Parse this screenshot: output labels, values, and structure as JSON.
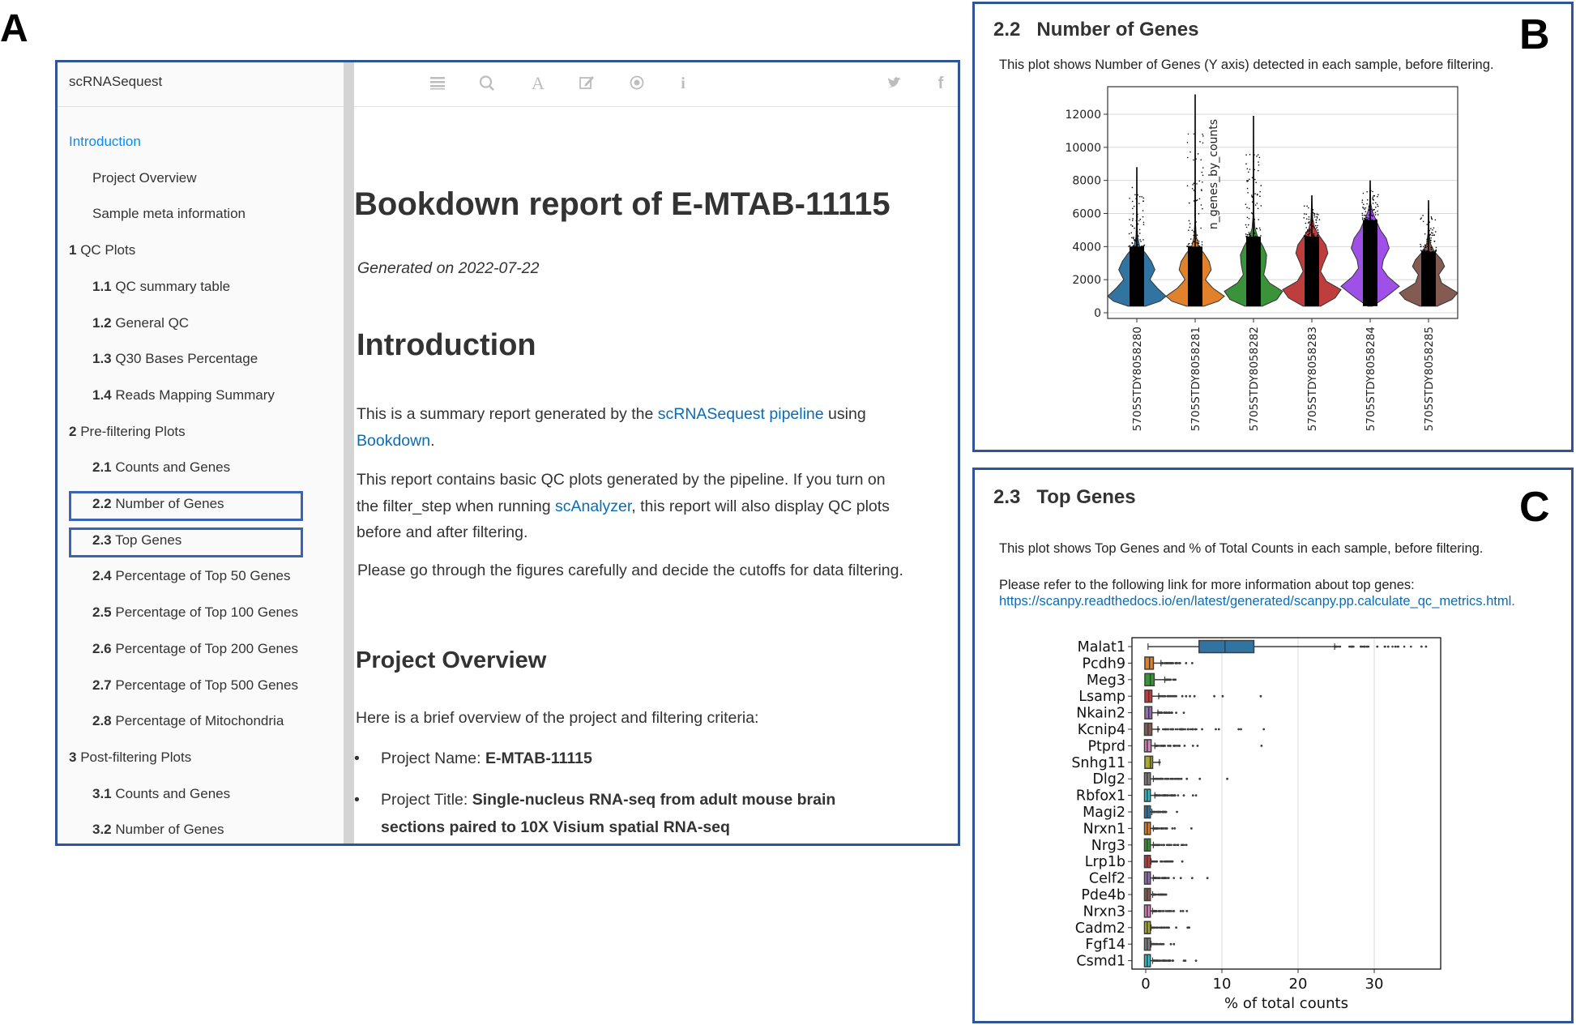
{
  "labels": {
    "a": "A",
    "b": "B",
    "c": "C"
  },
  "sidebar": {
    "title": "scRNASequest",
    "items": [
      {
        "num": "",
        "label": "Introduction",
        "level": 1,
        "active": true
      },
      {
        "num": "",
        "label": "Project Overview",
        "level": 2
      },
      {
        "num": "",
        "label": "Sample meta information",
        "level": 2
      },
      {
        "num": "1",
        "label": "QC Plots",
        "level": 1
      },
      {
        "num": "1.1",
        "label": "QC summary table",
        "level": 2
      },
      {
        "num": "1.2",
        "label": "General QC",
        "level": 2
      },
      {
        "num": "1.3",
        "label": "Q30 Bases Percentage",
        "level": 2
      },
      {
        "num": "1.4",
        "label": "Reads Mapping Summary",
        "level": 2
      },
      {
        "num": "2",
        "label": "Pre-filtering Plots",
        "level": 1
      },
      {
        "num": "2.1",
        "label": "Counts and Genes",
        "level": 2
      },
      {
        "num": "2.2",
        "label": "Number of Genes",
        "level": 2,
        "highlighted": true
      },
      {
        "num": "2.3",
        "label": "Top Genes",
        "level": 2,
        "highlighted": true
      },
      {
        "num": "2.4",
        "label": "Percentage of Top 50 Genes",
        "level": 2
      },
      {
        "num": "2.5",
        "label": "Percentage of Top 100 Genes",
        "level": 2
      },
      {
        "num": "2.6",
        "label": "Percentage of Top 200 Genes",
        "level": 2
      },
      {
        "num": "2.7",
        "label": "Percentage of Top 500 Genes",
        "level": 2
      },
      {
        "num": "2.8",
        "label": "Percentage of Mitochondria",
        "level": 2
      },
      {
        "num": "3",
        "label": "Post-filtering Plots",
        "level": 1
      },
      {
        "num": "3.1",
        "label": "Counts and Genes",
        "level": 2
      },
      {
        "num": "3.2",
        "label": "Number of Genes",
        "level": 2
      }
    ]
  },
  "toolbar": {
    "left_icons": [
      "menu-icon",
      "search-icon",
      "font-icon",
      "edit-icon",
      "eye-icon",
      "info-icon"
    ],
    "right_icons": [
      "twitter-icon",
      "facebook-icon",
      "share-icon"
    ]
  },
  "main": {
    "title": "Bookdown report of E-MTAB-11115",
    "generated": "Generated on 2022-07-22",
    "intro_heading": "Introduction",
    "p1_a": "This is a summary report generated by the ",
    "p1_link": "scRNASequest pipeline",
    "p1_b": " using",
    "p1_link2": "Bookdown",
    "p1_c": ".",
    "p2_line1": "This report contains basic QC plots generated by the pipeline. If you turn on",
    "p2_a": "the filter_step when running ",
    "p2_link": "scAnalyzer",
    "p2_b": ", this report will also display QC plots",
    "p2_line3": "before and after filtering.",
    "p3": "Please go through the figures carefully and decide the cutoffs for data filtering.",
    "overview_heading": "Project Overview",
    "overview_intro": "Here is a brief overview of the project and filtering criteria:",
    "bullet": "•",
    "project_name_label": "Project Name: ",
    "project_name": "E-MTAB-11115",
    "project_title_label": "Project Title: ",
    "project_title_line1": "Single-nucleus RNA-seq from adult mouse brain",
    "project_title_line2": "sections paired to 10X Visium spatial RNA-seq"
  },
  "panel_b": {
    "section_num": "2.2",
    "section_title": "Number of Genes",
    "description": "This plot shows Number of Genes (Y axis) detected in each sample, before filtering."
  },
  "panel_c": {
    "section_num": "2.3",
    "section_title": "Top Genes",
    "description": "This plot shows Top Genes and % of Total Counts in each sample, before filtering.",
    "refer": "Please refer to the following link for more information about top genes:",
    "link": "https://scanpy.readthedocs.io/en/latest/generated/scanpy.pp.calculate_qc_metrics.html."
  },
  "chart_data": [
    {
      "type": "violin",
      "ylabel": "n_genes_by_counts",
      "xlabel": "",
      "ylim": [
        -340,
        13660
      ],
      "yticks": [
        0,
        2000,
        4000,
        6000,
        8000,
        10000,
        12000
      ],
      "grid": true,
      "categories": [
        "5705STDY8058280",
        "5705STDY8058281",
        "5705STDY8058282",
        "5705STDY8058283",
        "5705STDY8058284",
        "5705STDY8058285"
      ],
      "colors": [
        "#3274a1",
        "#e1812c",
        "#3a923a",
        "#c03d3e",
        "#9f50e6",
        "#845b53"
      ],
      "series": [
        {
          "min": 400,
          "max": 8800,
          "density": [
            [
              400,
              0.3
            ],
            [
              700,
              0.8
            ],
            [
              1000,
              1.0
            ],
            [
              1500,
              0.7
            ],
            [
              2000,
              0.45
            ],
            [
              2600,
              0.62
            ],
            [
              3100,
              0.5
            ],
            [
              3600,
              0.3
            ],
            [
              4000,
              0.1
            ],
            [
              4600,
              0.03
            ],
            [
              5500,
              0.01
            ]
          ]
        },
        {
          "min": 400,
          "max": 13200,
          "density": [
            [
              400,
              0.3
            ],
            [
              700,
              0.8
            ],
            [
              1000,
              1.0
            ],
            [
              1500,
              0.6
            ],
            [
              2000,
              0.35
            ],
            [
              2600,
              0.55
            ],
            [
              3100,
              0.48
            ],
            [
              3600,
              0.3
            ],
            [
              4000,
              0.12
            ],
            [
              4600,
              0.04
            ],
            [
              5500,
              0.01
            ]
          ]
        },
        {
          "min": 400,
          "max": 11900,
          "density": [
            [
              400,
              0.3
            ],
            [
              800,
              0.8
            ],
            [
              1300,
              1.0
            ],
            [
              1800,
              0.55
            ],
            [
              2300,
              0.35
            ],
            [
              2900,
              0.42
            ],
            [
              3500,
              0.45
            ],
            [
              4000,
              0.33
            ],
            [
              4600,
              0.14
            ],
            [
              5100,
              0.05
            ],
            [
              6000,
              0.01
            ]
          ]
        },
        {
          "min": 400,
          "max": 7100,
          "density": [
            [
              400,
              0.3
            ],
            [
              900,
              0.8
            ],
            [
              1400,
              1.0
            ],
            [
              1900,
              0.5
            ],
            [
              2500,
              0.3
            ],
            [
              3000,
              0.4
            ],
            [
              3600,
              0.55
            ],
            [
              4100,
              0.48
            ],
            [
              4600,
              0.28
            ],
            [
              5100,
              0.1
            ],
            [
              5700,
              0.03
            ]
          ]
        },
        {
          "min": 400,
          "max": 8000,
          "density": [
            [
              400,
              0.08
            ],
            [
              900,
              0.5
            ],
            [
              1600,
              1.0
            ],
            [
              2200,
              0.6
            ],
            [
              2700,
              0.4
            ],
            [
              3200,
              0.45
            ],
            [
              3900,
              0.65
            ],
            [
              4500,
              0.55
            ],
            [
              5000,
              0.35
            ],
            [
              5600,
              0.2
            ],
            [
              6100,
              0.08
            ],
            [
              6600,
              0.02
            ]
          ]
        },
        {
          "min": 400,
          "max": 6800,
          "density": [
            [
              400,
              0.3
            ],
            [
              800,
              0.8
            ],
            [
              1200,
              1.0
            ],
            [
              1800,
              0.45
            ],
            [
              2300,
              0.35
            ],
            [
              2800,
              0.55
            ],
            [
              3200,
              0.45
            ],
            [
              3700,
              0.2
            ],
            [
              4200,
              0.06
            ],
            [
              4800,
              0.02
            ]
          ]
        }
      ]
    },
    {
      "type": "boxplot",
      "orientation": "horizontal",
      "xlabel": "% of total counts",
      "xlim": [
        -1.9,
        38.8
      ],
      "xticks": [
        0,
        10,
        20,
        30
      ],
      "grid": true,
      "colors": [
        "#3274a1",
        "#e1812c",
        "#3a923a",
        "#c03d3e",
        "#9372b2",
        "#845b53",
        "#d684bd",
        "#a9aa35",
        "#7f7f7f",
        "#2ebece"
      ],
      "genes": [
        "Malat1",
        "Pcdh9",
        "Meg3",
        "Lsamp",
        "Nkain2",
        "Kcnip4",
        "Ptprd",
        "Snhg11",
        "Dlg2",
        "Rbfox1",
        "Magi2",
        "Nrxn1",
        "Nrg3",
        "Lrp1b",
        "Celf2",
        "Pde4b",
        "Nrxn3",
        "Cadm2",
        "Fgf14",
        "Csmd1"
      ],
      "boxes": [
        {
          "whislo": 0.3,
          "q1": 7.0,
          "med": 10.4,
          "q3": 14.2,
          "whishi": 24.8,
          "outliers_to": 35.5,
          "outliers": [
            36.2,
            36.8
          ]
        },
        {
          "whislo": 0,
          "q1": 0.1,
          "med": 0.5,
          "q3": 0.9,
          "whishi": 2.0,
          "outliers_to": 4.6,
          "outliers": [
            5.3,
            6.1
          ]
        },
        {
          "whislo": 0,
          "q1": 0.1,
          "med": 0.6,
          "q3": 1.0,
          "whishi": 2.5,
          "outliers_to": 4.0,
          "outliers": []
        },
        {
          "whislo": 0,
          "q1": 0.1,
          "med": 0.4,
          "q3": 0.7,
          "whishi": 1.7,
          "outliers_to": 4.2,
          "outliers": [
            4.8,
            5.3,
            5.8,
            6.4,
            9.0,
            10.1,
            15.1
          ]
        },
        {
          "whislo": 0,
          "q1": 0.1,
          "med": 0.4,
          "q3": 0.7,
          "whishi": 1.6,
          "outliers_to": 3.5,
          "outliers": [
            4.0,
            5.0
          ]
        },
        {
          "whislo": 0,
          "q1": 0.05,
          "med": 0.3,
          "q3": 0.7,
          "whishi": 1.6,
          "outliers_to": 7.0,
          "outliers": [
            7.4,
            9.2,
            9.6,
            12.2,
            12.5,
            15.5
          ]
        },
        {
          "whislo": 0,
          "q1": 0.05,
          "med": 0.2,
          "q3": 0.6,
          "whishi": 1.2,
          "outliers_to": 4.5,
          "outliers": [
            5.1,
            6.2,
            6.8,
            15.2
          ]
        },
        {
          "whislo": 0,
          "q1": 0.1,
          "med": 0.6,
          "q3": 0.8,
          "whishi": 1.8,
          "outliers_to": 1.8,
          "outliers": []
        },
        {
          "whislo": 0,
          "q1": 0.05,
          "med": 0.2,
          "q3": 0.5,
          "whishi": 1.0,
          "outliers_to": 4.8,
          "outliers": [
            5.4,
            7.1,
            10.7
          ]
        },
        {
          "whislo": 0,
          "q1": 0.05,
          "med": 0.2,
          "q3": 0.5,
          "whishi": 1.2,
          "outliers_to": 4.3,
          "outliers": [
            5.0,
            6.2,
            6.6
          ]
        },
        {
          "whislo": 0,
          "q1": 0.05,
          "med": 0.2,
          "q3": 0.5,
          "whishi": 0.8,
          "outliers_to": 2.8,
          "outliers": [
            4.1
          ]
        },
        {
          "whislo": 0,
          "q1": 0.05,
          "med": 0.2,
          "q3": 0.5,
          "whishi": 1.0,
          "outliers_to": 2.8,
          "outliers": [
            3.5,
            3.8,
            6.0
          ]
        },
        {
          "whislo": 0,
          "q1": 0.05,
          "med": 0.2,
          "q3": 0.5,
          "whishi": 1.0,
          "outliers_to": 5.5,
          "outliers": []
        },
        {
          "whislo": 0,
          "q1": 0.05,
          "med": 0.2,
          "q3": 0.5,
          "whishi": 0.7,
          "outliers_to": 3.6,
          "outliers": [
            4.8
          ]
        },
        {
          "whislo": 0,
          "q1": 0.05,
          "med": 0.2,
          "q3": 0.5,
          "whishi": 1.0,
          "outliers_to": 3.8,
          "outliers": [
            4.6,
            6.1,
            8.1
          ]
        },
        {
          "whislo": 0,
          "q1": 0.05,
          "med": 0.2,
          "q3": 0.5,
          "whishi": 0.9,
          "outliers_to": 2.8,
          "outliers": []
        },
        {
          "whislo": 0,
          "q1": 0.05,
          "med": 0.2,
          "q3": 0.5,
          "whishi": 0.9,
          "outliers_to": 3.8,
          "outliers": [
            4.6,
            4.9,
            5.4
          ]
        },
        {
          "whislo": 0,
          "q1": 0.05,
          "med": 0.2,
          "q3": 0.5,
          "whishi": 0.7,
          "outliers_to": 3.1,
          "outliers": [
            4.0,
            5.5,
            5.7
          ]
        },
        {
          "whislo": 0,
          "q1": 0.05,
          "med": 0.2,
          "q3": 0.5,
          "whishi": 0.7,
          "outliers_to": 2.4,
          "outliers": [
            3.3,
            3.7
          ]
        },
        {
          "whislo": 0,
          "q1": 0.05,
          "med": 0.2,
          "q3": 0.5,
          "whishi": 0.9,
          "outliers_to": 3.9,
          "outliers": [
            5.0,
            5.2,
            6.6
          ]
        }
      ]
    }
  ]
}
